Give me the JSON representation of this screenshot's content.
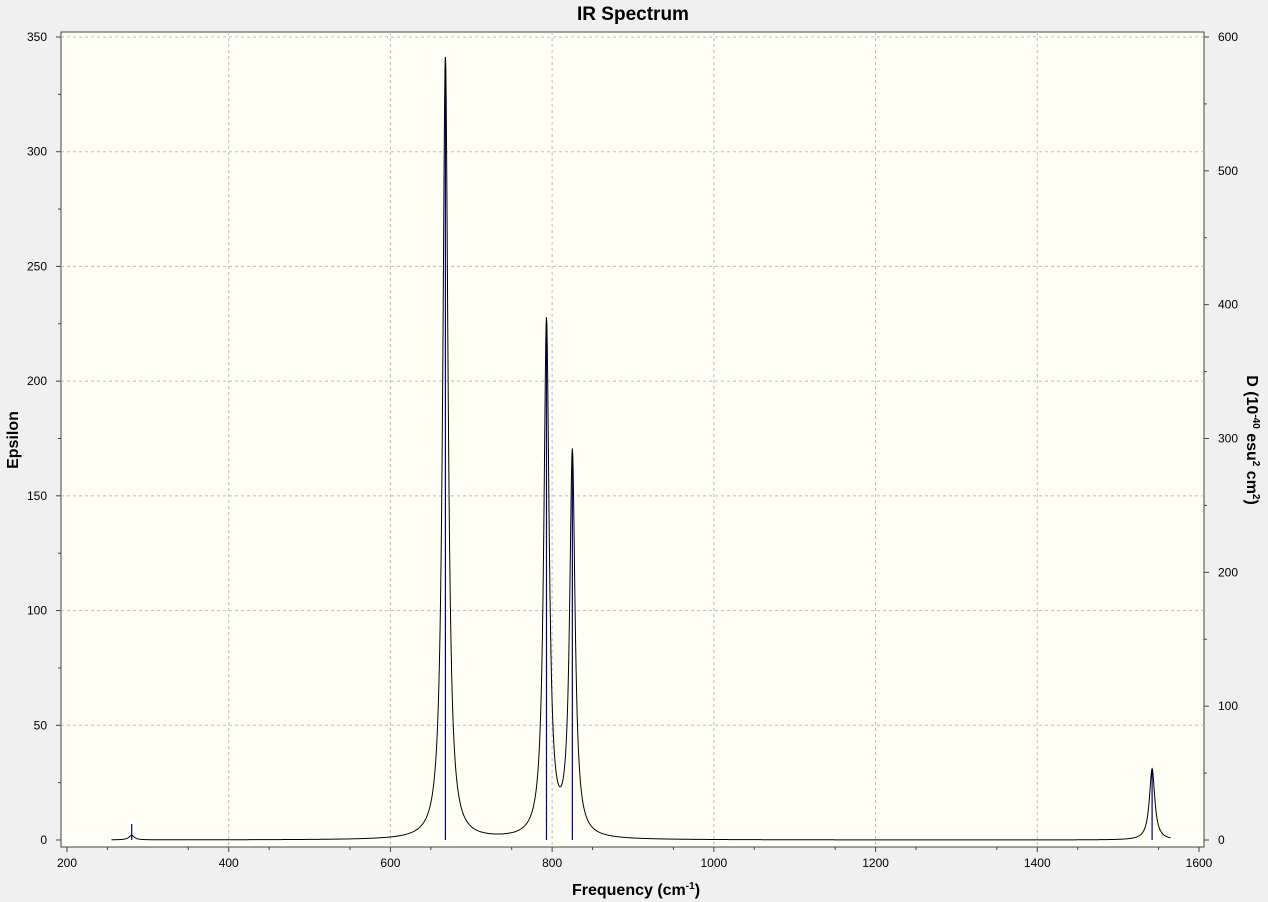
{
  "chart_data": {
    "type": "line",
    "title": "IR Spectrum",
    "xlabel": {
      "main": "Frequency (cm",
      "sup": "-1",
      "tail": ")"
    },
    "ylabel_left": "Epsilon",
    "ylabel_right": {
      "pre": "D (10",
      "sup1": "-40",
      "mid": " esu",
      "sup2": "2",
      "mid2": " cm",
      "sup3": "2",
      "tail": ")"
    },
    "xlim": [
      200,
      1600
    ],
    "ylim_left": [
      0,
      350
    ],
    "ylim_right": [
      0,
      600
    ],
    "x_ticks": [
      "200",
      "400",
      "600",
      "800",
      "1000",
      "1200",
      "1400",
      "1600"
    ],
    "y_ticks_left": [
      "0",
      "50",
      "100",
      "150",
      "200",
      "250",
      "300",
      "350"
    ],
    "y_ticks_right": [
      "0",
      "100",
      "200",
      "300",
      "400",
      "500",
      "600"
    ],
    "grid": true,
    "background": "#fffff5",
    "line_color": "#000000",
    "stick_color": "#00008b",
    "spectrum_range": [
      255,
      1565
    ],
    "peaks": [
      {
        "x": 280,
        "epsilon": 2,
        "fwhm": 8
      },
      {
        "x": 668,
        "epsilon": 341,
        "fwhm": 8
      },
      {
        "x": 793,
        "epsilon": 225,
        "fwhm": 8
      },
      {
        "x": 825,
        "epsilon": 167,
        "fwhm": 8
      },
      {
        "x": 1542,
        "epsilon": 31,
        "fwhm": 8
      }
    ],
    "sticks": [
      {
        "x": 280,
        "epsilon": 7
      },
      {
        "x": 668,
        "epsilon": 341
      },
      {
        "x": 793,
        "epsilon": 225
      },
      {
        "x": 825,
        "epsilon": 167
      },
      {
        "x": 1542,
        "epsilon": 31
      }
    ]
  }
}
